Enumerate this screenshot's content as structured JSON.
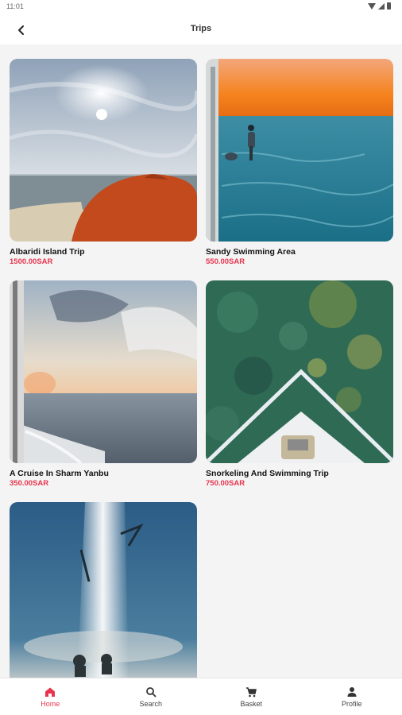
{
  "status_bar": {
    "time": "11:01"
  },
  "app_bar": {
    "title": "Trips",
    "back_icon": "arrow-back-icon"
  },
  "trips": [
    {
      "name": "Albaridi Island Trip",
      "price": "1500.00SAR"
    },
    {
      "name": "Sandy Swimming Area",
      "price": "550.00SAR"
    },
    {
      "name": "A Cruise In Sharm Yanbu",
      "price": "350.00SAR"
    },
    {
      "name": "Snorkeling And Swimming Trip",
      "price": "750.00SAR"
    }
  ],
  "bottom_nav": {
    "items": [
      {
        "label": "Home",
        "icon": "home-icon",
        "active": true
      },
      {
        "label": "Search",
        "icon": "search-icon",
        "active": false
      },
      {
        "label": "Basket",
        "icon": "cart-icon",
        "active": false
      },
      {
        "label": "Profile",
        "icon": "person-icon",
        "active": false
      }
    ]
  },
  "colors": {
    "accent": "#e8344e",
    "background": "#f4f4f4",
    "surface": "#ffffff"
  }
}
